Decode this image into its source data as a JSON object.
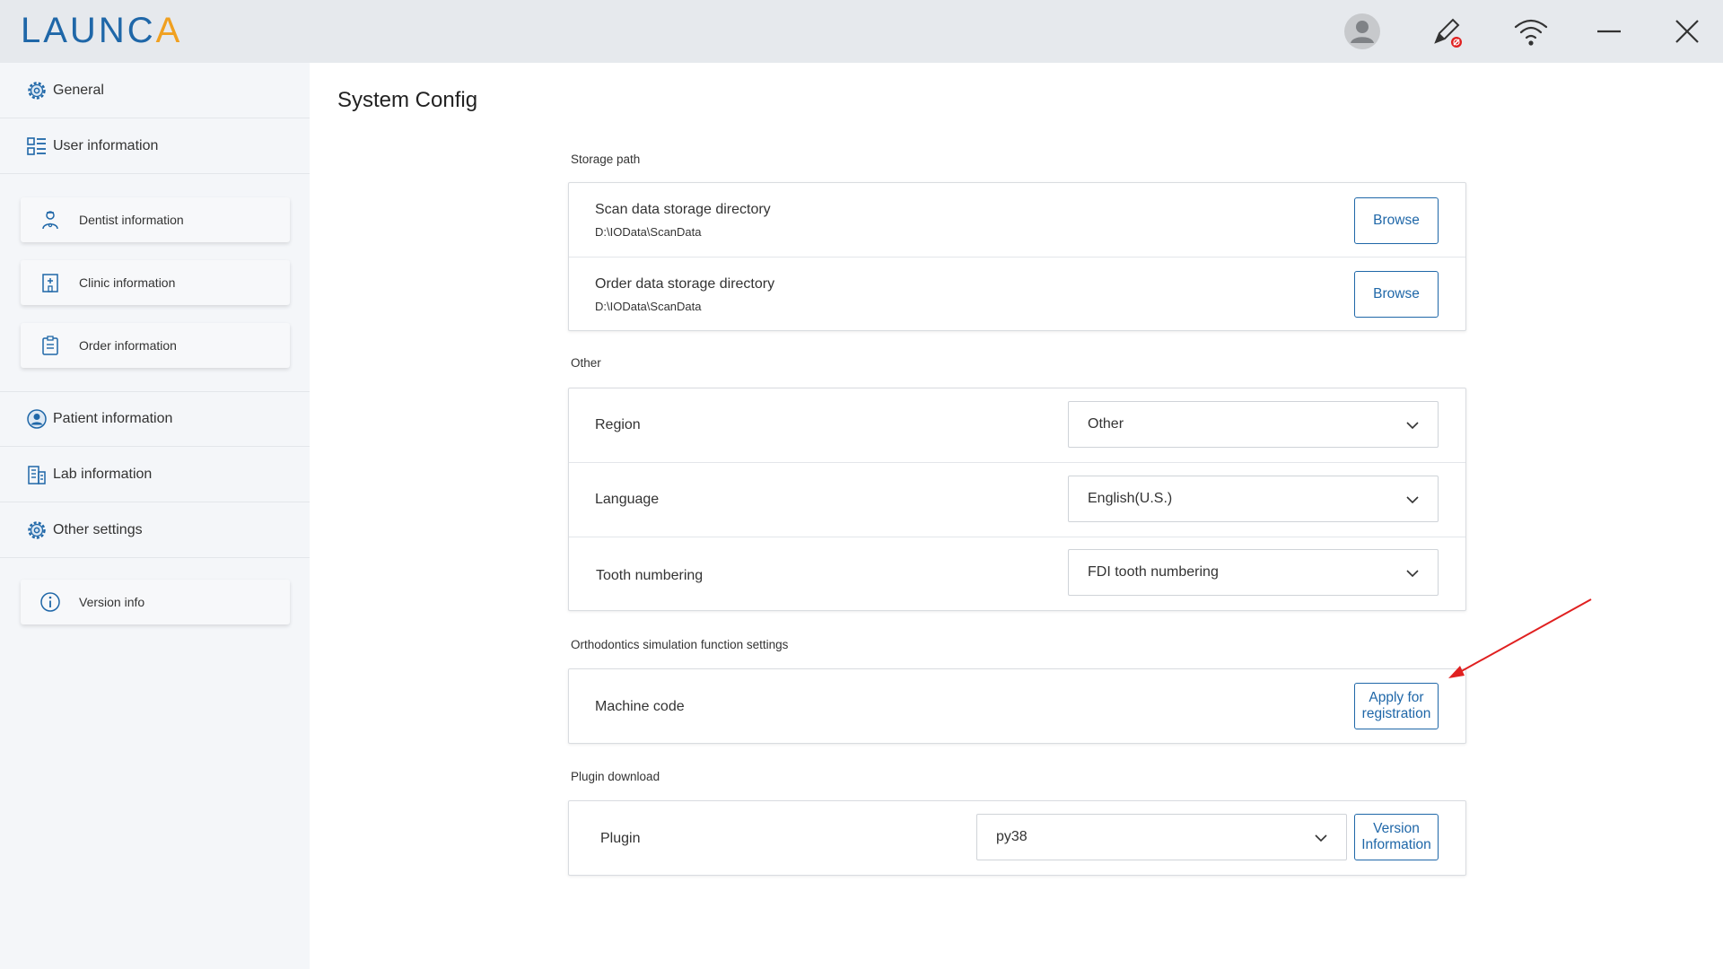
{
  "app": {
    "logo_main": "LAUNC",
    "logo_accent": "A"
  },
  "titlebar_icons": [
    "avatar-icon",
    "pen-disconnected-icon",
    "wifi-icon",
    "minimize-icon",
    "close-icon"
  ],
  "sidebar": {
    "general": "General",
    "user_information": "User information",
    "dentist_information": "Dentist information",
    "clinic_information": "Clinic information",
    "order_information": "Order information",
    "patient_information": "Patient information",
    "lab_information": "Lab information",
    "other_settings": "Other settings",
    "version_info": "Version info"
  },
  "main": {
    "title": "System Config",
    "storage": {
      "label": "Storage path",
      "scan_title": "Scan data storage directory",
      "scan_path": "D:\\IOData\\ScanData",
      "order_title": "Order data storage directory",
      "order_path": "D:\\IOData\\ScanData",
      "browse_label": "Browse"
    },
    "other": {
      "label": "Other",
      "region_label": "Region",
      "region_value": "Other",
      "language_label": "Language",
      "language_value": "English(U.S.)",
      "tooth_label": "Tooth numbering",
      "tooth_value": "FDI tooth numbering"
    },
    "ortho": {
      "label": "Orthodontics simulation function settings",
      "machine_code_label": "Machine code",
      "apply_line1": "Apply for",
      "apply_line2": "registration"
    },
    "plugin": {
      "label": "Plugin download",
      "plugin_label": "Plugin",
      "plugin_value": "py38",
      "version_line1": "Version",
      "version_line2": "Information"
    }
  },
  "colors": {
    "accent": "#1f67a8",
    "logo_accent": "#f0a020",
    "annotation_arrow": "#e02020",
    "sidebar_bg": "#f4f6f9",
    "titlebar_bg": "#e6e9ed"
  }
}
